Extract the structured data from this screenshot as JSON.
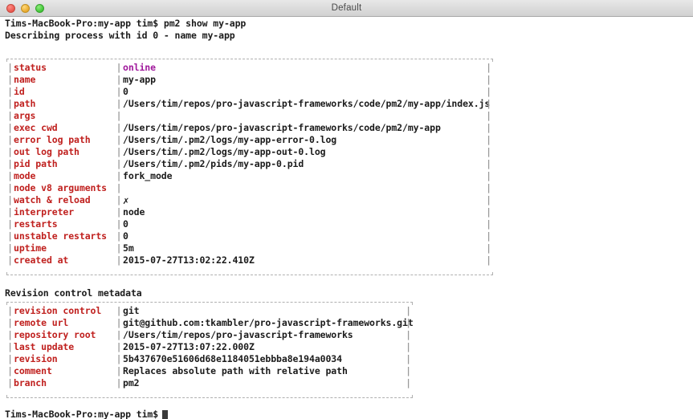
{
  "window": {
    "title": "Default",
    "controls": [
      {
        "name": "close",
        "color": "#e9564d"
      },
      {
        "name": "minimize",
        "color": "#e8a92c"
      },
      {
        "name": "maximize",
        "color": "#41c537"
      }
    ]
  },
  "terminal": {
    "prompt_command_line": "Tims-MacBook-Pro:my-app tim$ pm2 show my-app",
    "describe_line": "Describing process with id 0 - name my-app",
    "revision_heading": "Revision control metadata",
    "final_prompt": "Tims-MacBook-Pro:my-app tim$",
    "colors": {
      "key": "#c0211f",
      "value": "#1b1b1b",
      "status_online": "#a0189c",
      "border": "#b0b0b0",
      "pipe": "#9a9a9a",
      "background": "#ffffff"
    }
  },
  "process_table": {
    "rows": [
      {
        "key": "status",
        "value": "online",
        "style": "online"
      },
      {
        "key": "name",
        "value": "my-app",
        "style": ""
      },
      {
        "key": "id",
        "value": "0",
        "style": ""
      },
      {
        "key": "path",
        "value": "/Users/tim/repos/pro-javascript-frameworks/code/pm2/my-app/index.js",
        "style": ""
      },
      {
        "key": "args",
        "value": "",
        "style": ""
      },
      {
        "key": "exec cwd",
        "value": "/Users/tim/repos/pro-javascript-frameworks/code/pm2/my-app",
        "style": ""
      },
      {
        "key": "error log path",
        "value": "/Users/tim/.pm2/logs/my-app-error-0.log",
        "style": ""
      },
      {
        "key": "out log path",
        "value": "/Users/tim/.pm2/logs/my-app-out-0.log",
        "style": ""
      },
      {
        "key": "pid path",
        "value": "/Users/tim/.pm2/pids/my-app-0.pid",
        "style": ""
      },
      {
        "key": "mode",
        "value": "fork_mode",
        "style": ""
      },
      {
        "key": "node v8 arguments",
        "value": "",
        "style": ""
      },
      {
        "key": "watch & reload",
        "value": "✗",
        "style": "mark"
      },
      {
        "key": "interpreter",
        "value": "node",
        "style": ""
      },
      {
        "key": "restarts",
        "value": "0",
        "style": ""
      },
      {
        "key": "unstable restarts",
        "value": "0",
        "style": ""
      },
      {
        "key": "uptime",
        "value": "5m",
        "style": ""
      },
      {
        "key": "created at",
        "value": "2015-07-27T13:02:22.410Z",
        "style": ""
      }
    ]
  },
  "revision_table": {
    "rows": [
      {
        "key": "revision control",
        "value": "git",
        "style": ""
      },
      {
        "key": "remote url",
        "value": "git@github.com:tkambler/pro-javascript-frameworks.git",
        "style": ""
      },
      {
        "key": "repository root",
        "value": "/Users/tim/repos/pro-javascript-frameworks",
        "style": ""
      },
      {
        "key": "last update",
        "value": "2015-07-27T13:07:22.000Z",
        "style": ""
      },
      {
        "key": "revision",
        "value": "5b437670e51606d68e1184051ebbba8e194a0034",
        "style": ""
      },
      {
        "key": "comment",
        "value": "Replaces absolute path with relative path",
        "style": ""
      },
      {
        "key": "branch",
        "value": "pm2",
        "style": ""
      }
    ]
  }
}
